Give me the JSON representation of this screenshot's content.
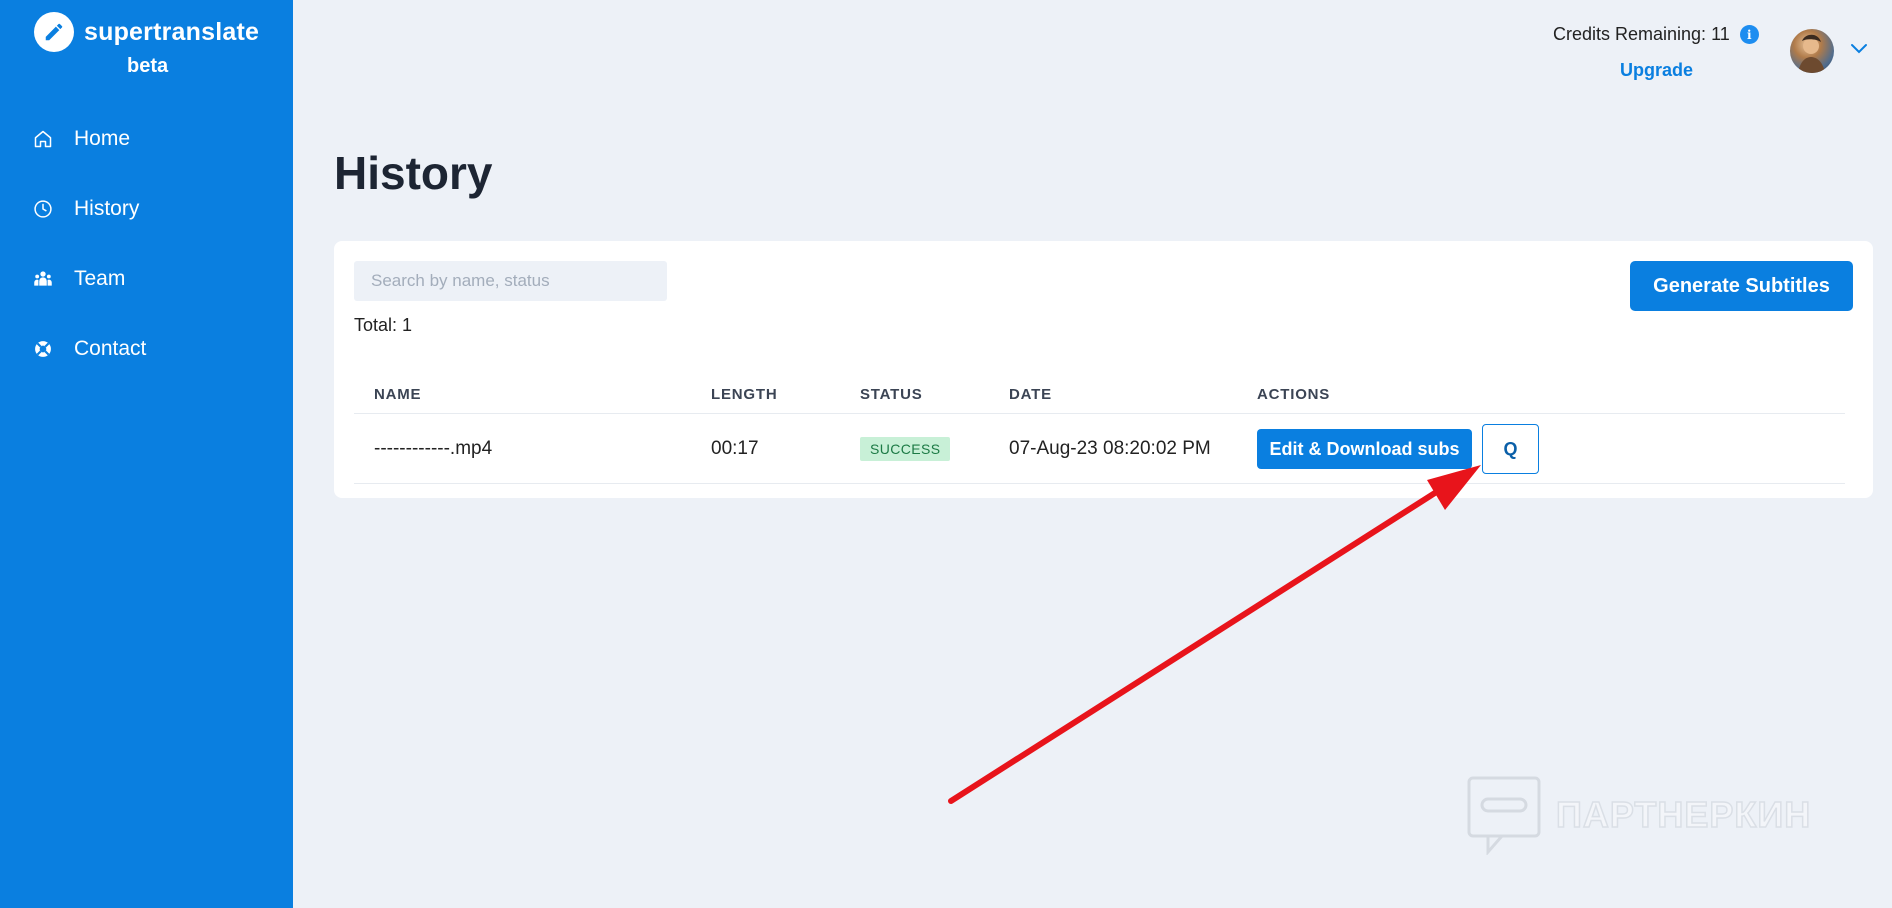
{
  "brand": {
    "name": "supertranslate",
    "tag": "beta"
  },
  "sidebar": {
    "items": [
      {
        "label": "Home",
        "icon": "home-icon"
      },
      {
        "label": "History",
        "icon": "clock-icon"
      },
      {
        "label": "Team",
        "icon": "team-icon"
      },
      {
        "label": "Contact",
        "icon": "lifebuoy-icon"
      }
    ]
  },
  "header": {
    "credits_text": "Credits Remaining: 11",
    "info_glyph": "i",
    "upgrade_label": "Upgrade"
  },
  "main": {
    "title": "History",
    "search_placeholder": "Search by name, status",
    "search_value": "",
    "total_text": "Total: 1",
    "generate_label": "Generate Subtitles",
    "columns": [
      "NAME",
      "LENGTH",
      "STATUS",
      "DATE",
      "ACTIONS"
    ],
    "rows": [
      {
        "name": "------------.mp4",
        "length": "00:17",
        "status": "SUCCESS",
        "date": "07-Aug-23 08:20:02 PM",
        "edit_label": "Edit & Download subs",
        "q_label": "Q"
      }
    ]
  },
  "annotation": {
    "arrow_color": "#e8141b"
  },
  "watermark": {
    "text": "ПАРТНЕРКИН"
  },
  "colors": {
    "accent": "#0a7fe0",
    "background": "#edf1f7",
    "success_bg": "#c8f0d7",
    "success_text": "#1c7a45"
  }
}
